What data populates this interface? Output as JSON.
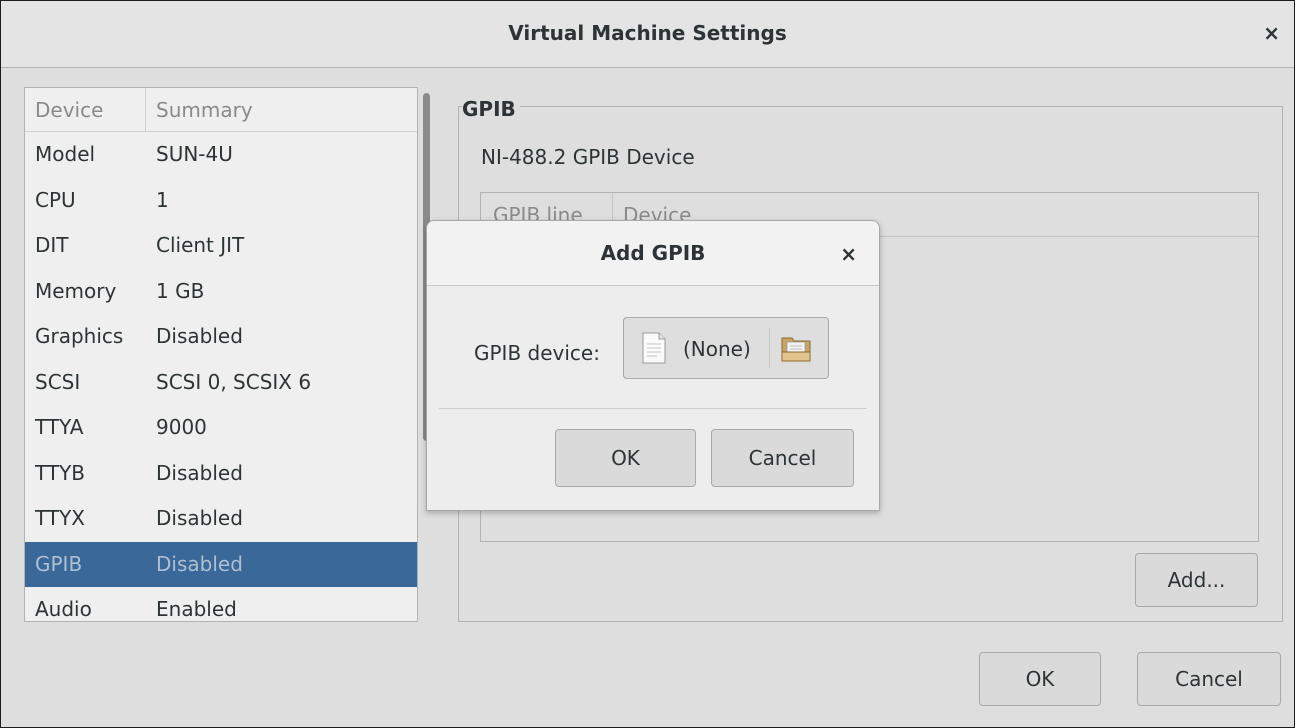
{
  "window": {
    "title": "Virtual Machine Settings",
    "close_symbol": "×"
  },
  "device_list": {
    "headers": [
      "Device",
      "Summary"
    ],
    "rows": [
      {
        "device": "Model",
        "summary": "SUN-4U"
      },
      {
        "device": "CPU",
        "summary": "1"
      },
      {
        "device": "DIT",
        "summary": "Client JIT"
      },
      {
        "device": "Memory",
        "summary": "1 GB"
      },
      {
        "device": "Graphics",
        "summary": "Disabled"
      },
      {
        "device": "SCSI",
        "summary": "SCSI 0, SCSIX 6"
      },
      {
        "device": "TTYA",
        "summary": "9000"
      },
      {
        "device": "TTYB",
        "summary": "Disabled"
      },
      {
        "device": "TTYX",
        "summary": "Disabled"
      },
      {
        "device": "GPIB",
        "summary": "Disabled",
        "selected": true
      },
      {
        "device": "Audio",
        "summary": "Enabled"
      }
    ],
    "selected_color": "#3a6899"
  },
  "gpib_panel": {
    "frame_label": "GPIB",
    "description": "NI-488.2 GPIB Device",
    "table_headers": [
      "GPIB line",
      "Device"
    ],
    "add_button": "Add..."
  },
  "footer": {
    "ok_label": "OK",
    "cancel_label": "Cancel"
  },
  "dialog": {
    "title": "Add GPIB",
    "close_symbol": "×",
    "field_label": "GPIB device:",
    "file_value": "(None)",
    "file_icon": "document-icon",
    "folder_icon": "folder-icon",
    "ok_label": "OK",
    "cancel_label": "Cancel"
  }
}
